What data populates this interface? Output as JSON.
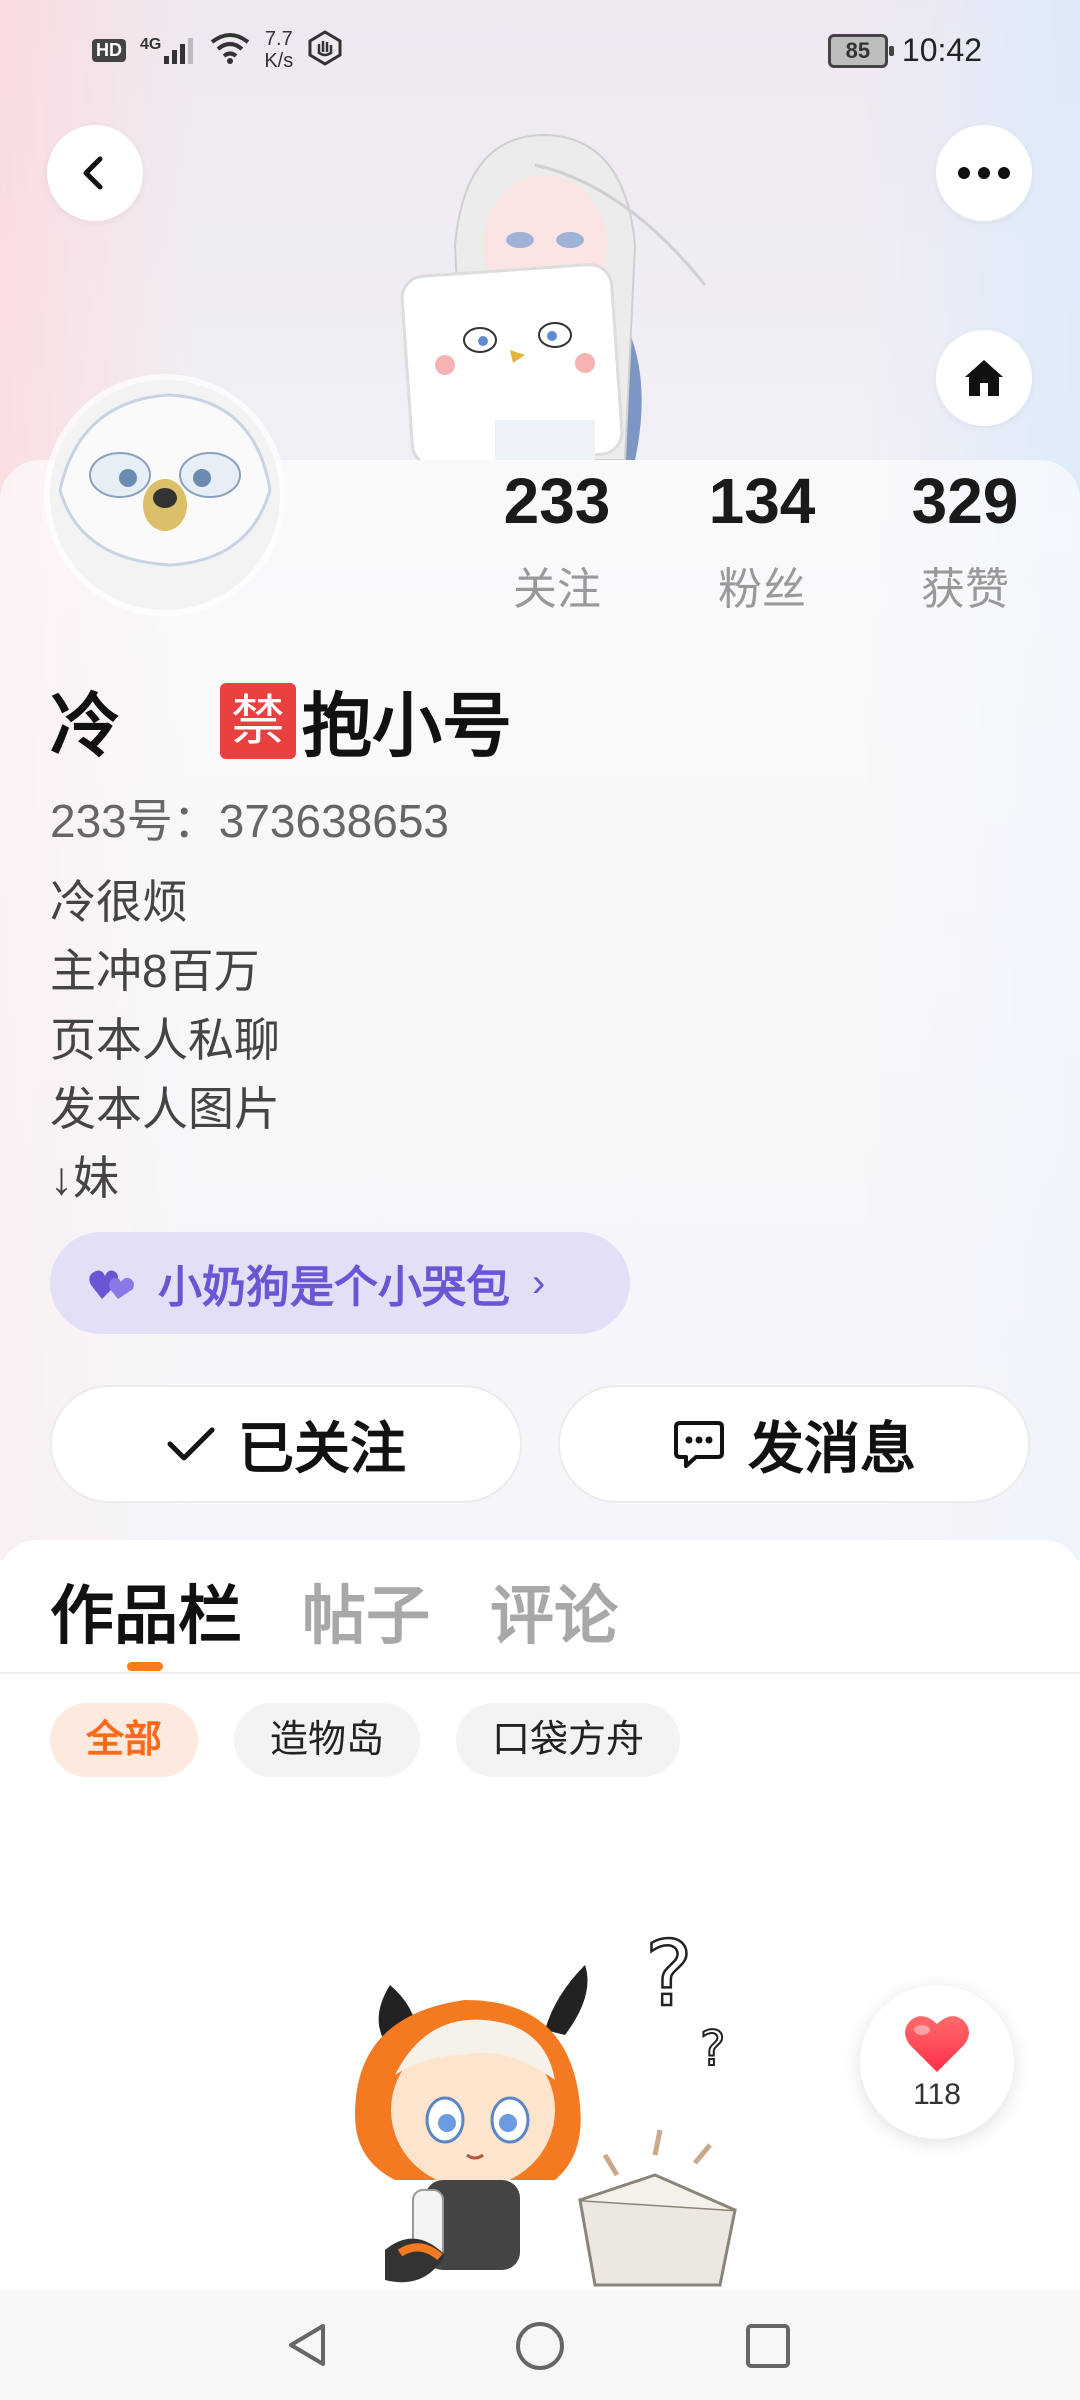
{
  "status_bar": {
    "hd": "HD",
    "network": "4G",
    "speed_value": "7.7",
    "speed_unit": "K/s",
    "battery": "85",
    "time": "10:42"
  },
  "profile": {
    "name_part1": "冷",
    "ban_char": "禁",
    "name_part2": "抱小号",
    "uid": "233号：373638653",
    "bio": [
      "冷很烦",
      "主冲8百万",
      "页本人私聊",
      "发本人图片",
      "↓妹"
    ]
  },
  "stats": [
    {
      "value": "233",
      "label": "关注"
    },
    {
      "value": "134",
      "label": "粉丝"
    },
    {
      "value": "329",
      "label": "获赞"
    }
  ],
  "relation_tag": {
    "text": "小奶狗是个小哭包",
    "arrow": "›"
  },
  "actions": {
    "follow": "已关注",
    "message": "发消息"
  },
  "tabs": [
    {
      "label": "作品栏",
      "active": true
    },
    {
      "label": "帖子",
      "active": false
    },
    {
      "label": "评论",
      "active": false
    }
  ],
  "filters": [
    {
      "label": "全部",
      "active": true
    },
    {
      "label": "造物岛",
      "active": false
    },
    {
      "label": "口袋方舟",
      "active": false
    }
  ],
  "like_fab": {
    "count": "118"
  },
  "colors": {
    "accent_orange": "#ff7a1a",
    "tag_purple": "#6a55d4",
    "heart_red": "#ff3b4e"
  }
}
